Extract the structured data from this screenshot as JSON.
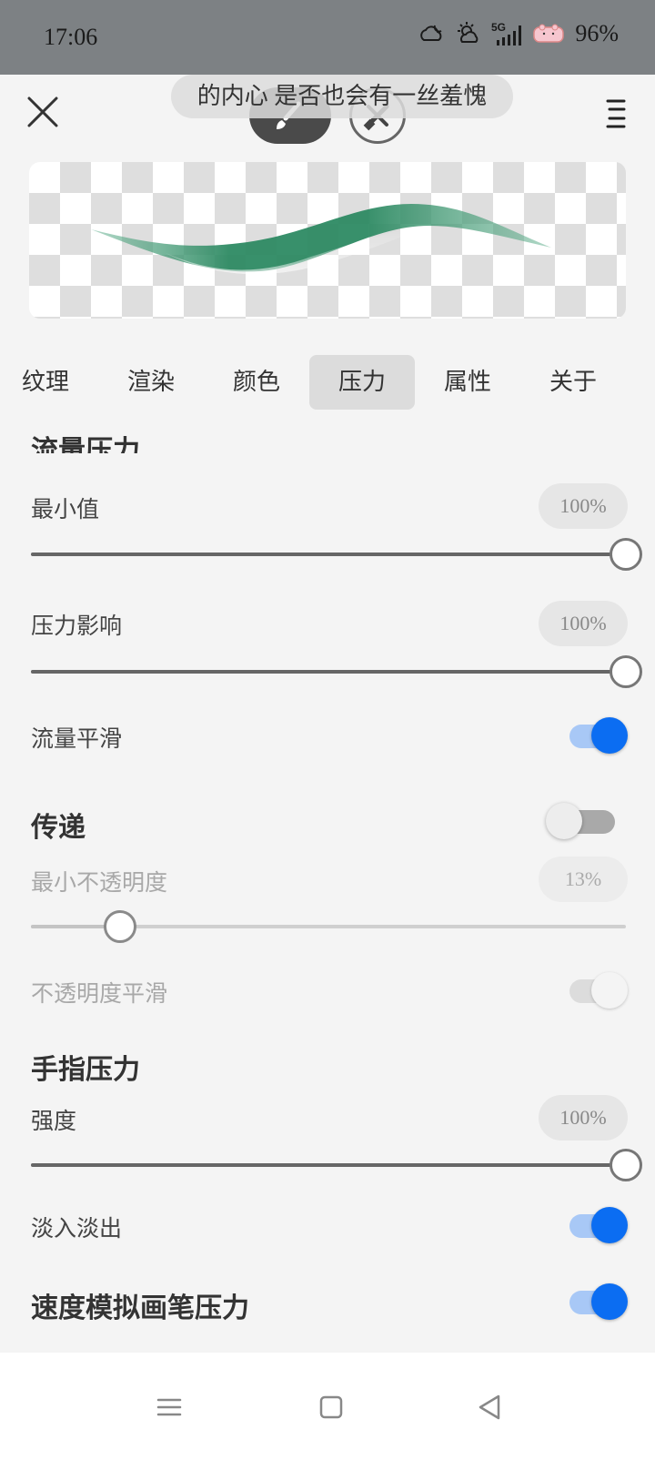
{
  "status_bar": {
    "time": "17:06",
    "network": "5G",
    "battery": "96%",
    "icons": [
      "cloud-moon-icon",
      "weather-icon",
      "5g-signal-icon",
      "battery-icon"
    ]
  },
  "header": {
    "toast_text": "的内心 是否也会有一丝羞愧",
    "close_icon": "close-icon",
    "brush_icon": "brush-icon",
    "eraser_icon": "eraser-icon",
    "menu_icon": "menu-icon"
  },
  "tabs": [
    {
      "label": "纹理"
    },
    {
      "label": "渲染"
    },
    {
      "label": "颜色"
    },
    {
      "label": "压力"
    },
    {
      "label": "属性"
    },
    {
      "label": "关于"
    }
  ],
  "settings": {
    "flow_pressure": {
      "title": "流量压力",
      "min_value": {
        "label": "最小值",
        "value": "100%",
        "level": 1.0
      },
      "pressure_effect": {
        "label": "压力影响",
        "value": "100%",
        "level": 1.0
      },
      "flow_smoothing": {
        "label": "流量平滑",
        "on": true
      }
    },
    "transfer": {
      "title": "传递",
      "on": false,
      "min_opacity": {
        "label": "最小不透明度",
        "value": "13%",
        "level": 0.15
      },
      "opacity_smoothing": {
        "label": "不透明度平滑",
        "on": false
      }
    },
    "finger_pressure": {
      "title": "手指压力",
      "strength": {
        "label": "强度",
        "value": "100%",
        "level": 1.0
      },
      "fade": {
        "label": "淡入淡出",
        "on": true
      }
    },
    "velocity_pressure": {
      "label": "速度模拟画笔压力",
      "on": true
    }
  },
  "nav_bar": {
    "icons": [
      "menu-nav-icon",
      "home-icon",
      "back-icon"
    ]
  },
  "colors": {
    "accent": "#0b6df2",
    "stroke_green": "#2e8a63"
  }
}
